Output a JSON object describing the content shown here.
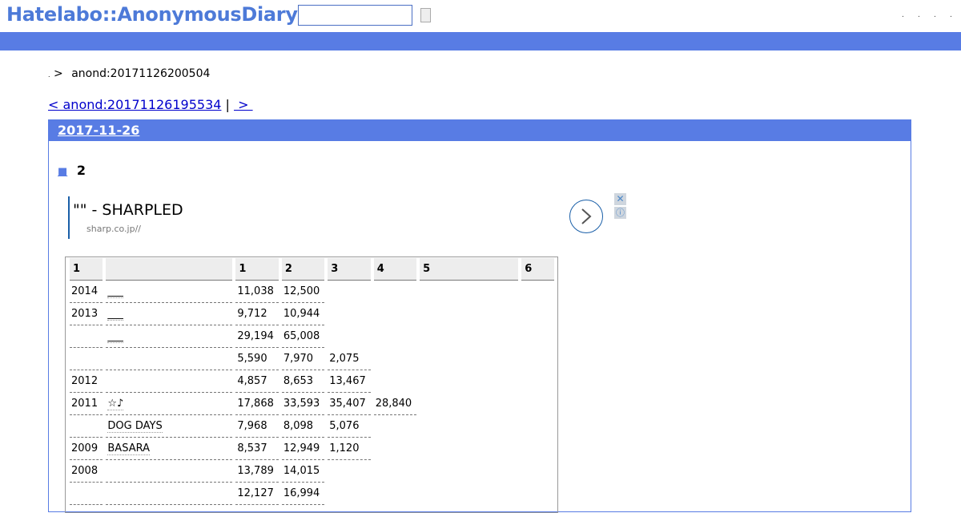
{
  "header": {
    "logo": "Hatelabo::AnonymousDiary",
    "search_value": "",
    "nav_links": [
      ".",
      ".",
      ".",
      "."
    ]
  },
  "breadcrumb": {
    "home": ".",
    "separator": ">",
    "current": "anond:20171126200504"
  },
  "pager": {
    "prev": "< anond:20171126195534",
    "separator": "|",
    "next": " > "
  },
  "day": {
    "date": "2017-11-26"
  },
  "entry": {
    "section_mark": "■",
    "title": "2"
  },
  "ad": {
    "title": "\"\" - SHARPLED",
    "url": "sharp.co.jp//",
    "close": "✕",
    "info": "ⓘ"
  },
  "table": {
    "headers": [
      "1",
      "",
      "1",
      "2",
      "3",
      "4",
      "5",
      "6"
    ],
    "rows": [
      [
        "2014",
        "___",
        "11,038",
        "12,500",
        "",
        "",
        "",
        ""
      ],
      [
        "2013",
        "___",
        "9,712",
        "10,944",
        "",
        "",
        "",
        ""
      ],
      [
        "",
        "___",
        "29,194",
        "65,008",
        "",
        "",
        "",
        ""
      ],
      [
        "",
        "",
        "5,590",
        "7,970",
        "2,075",
        "",
        "",
        ""
      ],
      [
        "2012",
        "",
        "4,857",
        "8,653",
        "13,467",
        "",
        "",
        ""
      ],
      [
        "2011",
        "☆♪",
        "17,868",
        "33,593",
        "35,407",
        "28,840",
        "",
        ""
      ],
      [
        "",
        "DOG DAYS",
        "7,968",
        "8,098",
        "5,076",
        "",
        "",
        ""
      ],
      [
        "2009",
        "BASARA",
        "8,537",
        "12,949",
        "1,120",
        "",
        "",
        ""
      ],
      [
        "2008",
        "",
        "13,789",
        "14,015",
        "",
        "",
        "",
        ""
      ],
      [
        "",
        "",
        "12,127",
        "16,994",
        "",
        "",
        "",
        ""
      ],
      [
        "",
        "",
        "",
        "",
        "",
        "",
        "",
        ""
      ]
    ]
  },
  "colors": {
    "brand": "#4d7ad8",
    "bar": "#587ce4",
    "ad_accent": "#1a5fa8"
  }
}
